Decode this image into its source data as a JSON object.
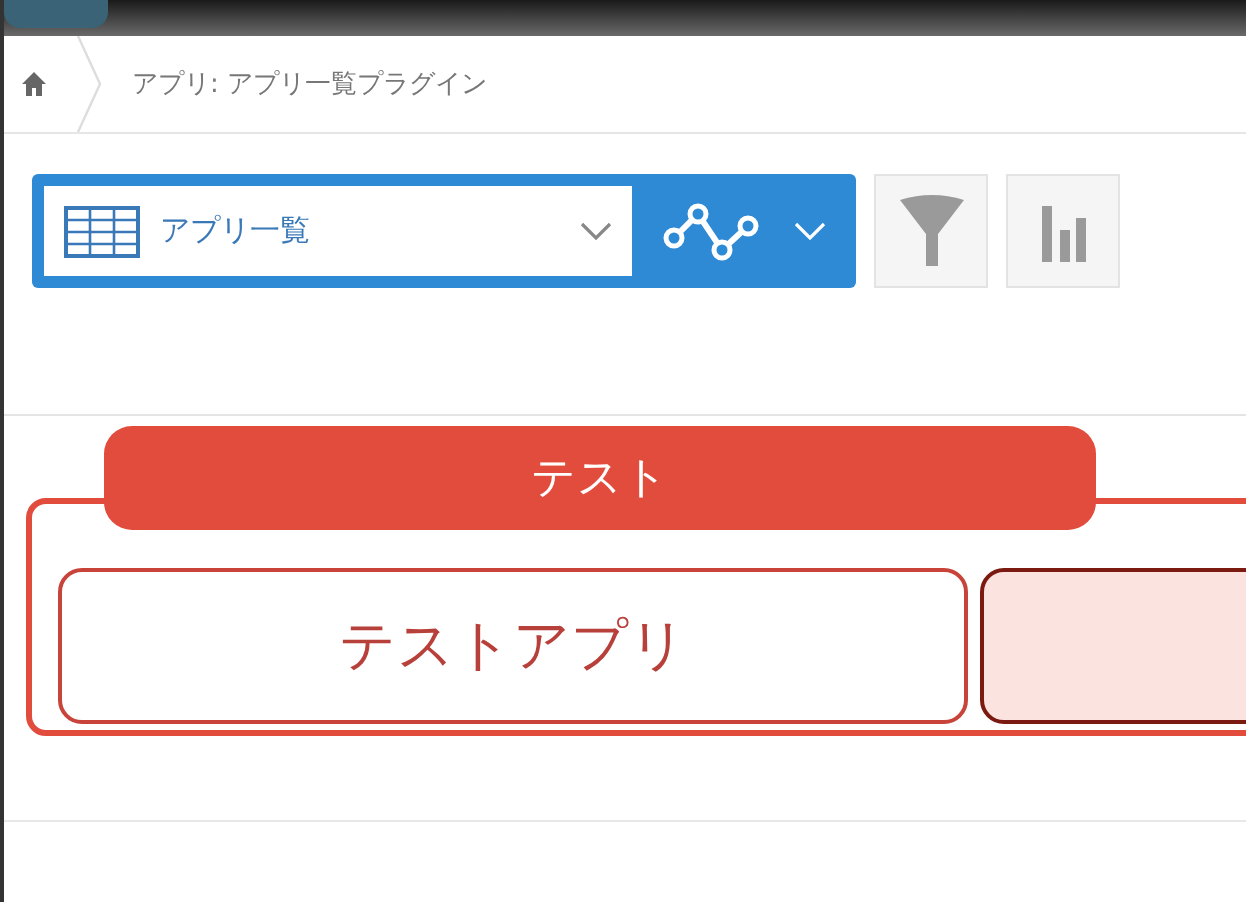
{
  "breadcrumb": {
    "path": "アプリ: アプリ一覧プラグイン"
  },
  "toolbar": {
    "view_select": {
      "value": "アプリ一覧"
    }
  },
  "group": {
    "title": "テスト",
    "tiles": [
      {
        "label": "テストアプリ",
        "selected": false
      },
      {
        "selected": true
      }
    ]
  }
}
